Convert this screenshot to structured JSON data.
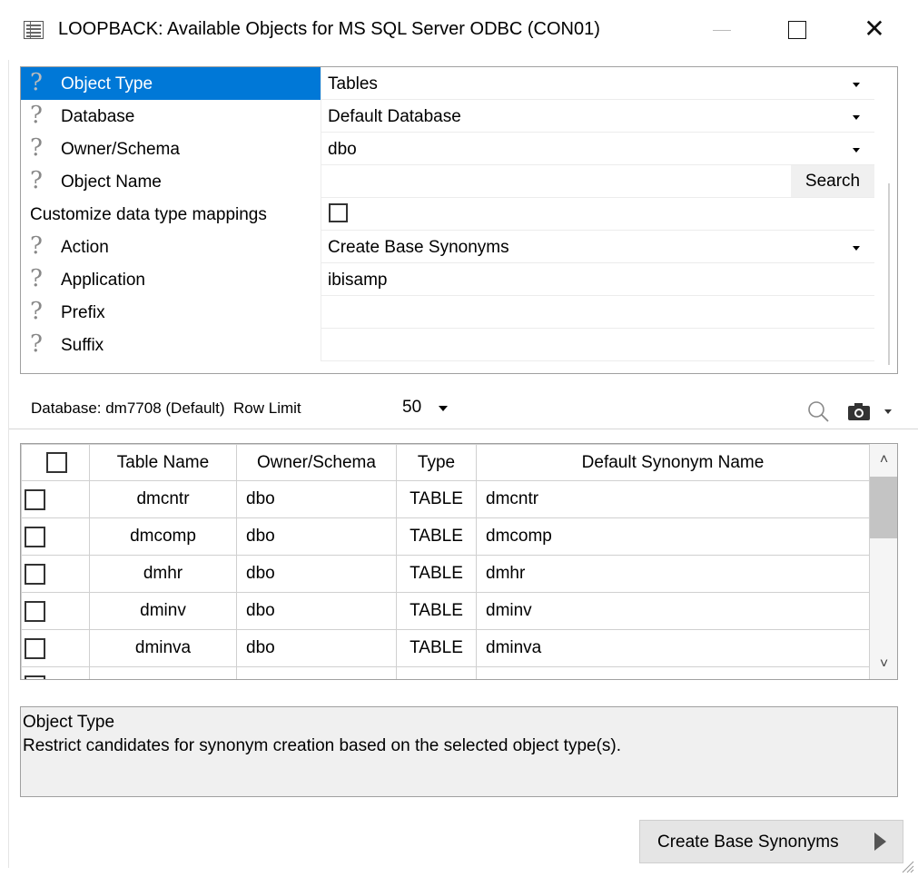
{
  "window": {
    "title": "LOOPBACK: Available Objects for MS SQL Server ODBC (CON01)",
    "close_glyph": "✕"
  },
  "properties": [
    {
      "label": "Object Type",
      "value": "Tables",
      "has_dropdown": true,
      "selected": true
    },
    {
      "label": "Database",
      "value": "Default Database",
      "has_dropdown": true
    },
    {
      "label": "Owner/Schema",
      "value": "dbo",
      "has_dropdown": true
    },
    {
      "label": "Object Name",
      "value": "",
      "button": "Search"
    },
    {
      "label": "Customize data type mappings",
      "value": "",
      "checkbox": true
    },
    {
      "label": "Action",
      "value": "Create Base Synonyms",
      "has_dropdown": true
    },
    {
      "label": "Application",
      "value": "ibisamp"
    },
    {
      "label": "Prefix",
      "value": ""
    },
    {
      "label": "Suffix",
      "value": ""
    }
  ],
  "question_glyph": "?",
  "infobar": {
    "database": "Database: dm7708 (Default)",
    "row_limit_label": "Row Limit",
    "row_limit_value": "50"
  },
  "table": {
    "columns": [
      "Table Name",
      "Owner/Schema",
      "Type",
      "Default Synonym Name"
    ],
    "rows": [
      [
        "dmcntr",
        "dbo",
        "TABLE",
        "dmcntr"
      ],
      [
        "dmcomp",
        "dbo",
        "TABLE",
        "dmcomp"
      ],
      [
        "dmhr",
        "dbo",
        "TABLE",
        "dmhr"
      ],
      [
        "dminv",
        "dbo",
        "TABLE",
        "dminv"
      ],
      [
        "dminva",
        "dbo",
        "TABLE",
        "dminva"
      ]
    ],
    "scroll_up": "˄",
    "scroll_down": "˅"
  },
  "description": {
    "title": "Object Type",
    "text": "Restrict candidates for synonym creation based on the selected object type(s)."
  },
  "action_button": {
    "label": "Create Base Synonyms"
  },
  "colors": {
    "selection": "#0078d7"
  }
}
